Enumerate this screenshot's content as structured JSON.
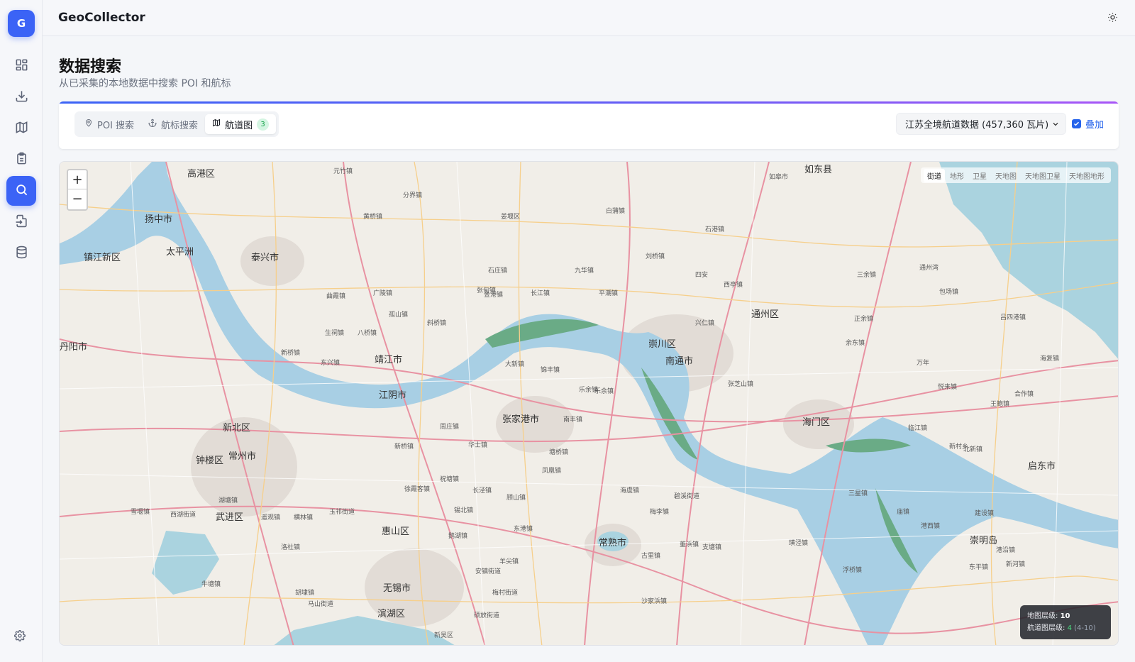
{
  "app": {
    "logo_letter": "G",
    "title": "GeoCollector"
  },
  "sidebar": {
    "items": [
      {
        "icon": "dashboard-icon"
      },
      {
        "icon": "download-icon"
      },
      {
        "icon": "map-icon"
      },
      {
        "icon": "clipboard-icon"
      },
      {
        "icon": "search-icon",
        "active": true
      },
      {
        "icon": "file-import-icon"
      },
      {
        "icon": "database-icon"
      }
    ],
    "settings_icon": "gear-icon"
  },
  "page": {
    "title": "数据搜索",
    "subtitle": "从已采集的本地数据中搜索 POI 和航标"
  },
  "tabs": [
    {
      "label": "POI 搜索",
      "icon": "pin-icon"
    },
    {
      "label": "航标搜索",
      "icon": "anchor-icon"
    },
    {
      "label": "航道图",
      "icon": "map-icon",
      "badge": "3",
      "active": true
    }
  ],
  "dataset": {
    "selected": "江苏全境航道数据 (457,360 瓦片)"
  },
  "overlay": {
    "label": "叠加",
    "checked": true
  },
  "map": {
    "zoom_in": "+",
    "zoom_out": "−",
    "layers": [
      "街道",
      "地形",
      "卫星",
      "天地图",
      "天地图卫星",
      "天地图地形"
    ],
    "active_layer": "街道",
    "info": {
      "map_zoom_label": "地图层级:",
      "map_zoom_value": "10",
      "chart_zoom_label": "航道图层级:",
      "chart_zoom_value": "4",
      "chart_zoom_range": "(4-10)"
    },
    "city_labels": [
      "高港区",
      "扬中市",
      "镇江新区",
      "泰兴市",
      "靖江市",
      "江阴市",
      "张家港市",
      "南通市",
      "崇川区",
      "通州区",
      "海门区",
      "启东市",
      "崇明岛",
      "常熟市",
      "无锡市",
      "常州市",
      "新北区",
      "钟楼区",
      "武进区",
      "惠山区",
      "滨湖区",
      "如东县",
      "太平洲",
      "丹阳市"
    ],
    "town_labels": [
      "如皋市",
      "白蒲镇",
      "石港镇",
      "九华镇",
      "平潮镇",
      "刘桥镇",
      "四安",
      "西亭镇",
      "兴仁镇",
      "张芝山镇",
      "三余镇",
      "通州湾",
      "包场镇",
      "吕四港镇",
      "海复镇",
      "正余镇",
      "余东镇",
      "万年",
      "悦来镇",
      "合作镇",
      "王鲍镇",
      "北新镇",
      "临江镇",
      "新村乡",
      "三星镇",
      "庙镇",
      "港西镇",
      "建设镇",
      "东平镇",
      "新河镇",
      "港沿镇",
      "支塘镇",
      "梅李镇",
      "碧溪街道",
      "海虞镇",
      "董浜镇",
      "古里镇",
      "沙家浜镇",
      "浮桥镇",
      "璜泾镇",
      "乐余镇",
      "锦丰镇",
      "大新镇",
      "金港镇",
      "长江镇",
      "孤山镇",
      "斜桥镇",
      "东兴镇",
      "新桥镇",
      "生祠镇",
      "八桥镇",
      "广陵镇",
      "曲霞镇",
      "黄桥镇",
      "分界镇",
      "元竹镇",
      "石庄镇",
      "张甸镇",
      "姜堰区",
      "周庄镇",
      "华士镇",
      "新桥镇",
      "长泾镇",
      "祝塘镇",
      "徐霞客镇",
      "顾山镇",
      "凤凰镇",
      "塘桥镇",
      "南丰镇",
      "乐余镇",
      "东港镇",
      "安镇街道",
      "鹅湖镇",
      "羊尖镇",
      "锡北镇",
      "洛社镇",
      "玉祁街道",
      "横林镇",
      "遥观镇",
      "湖塘镇",
      "西湖街道",
      "牛塘镇",
      "雪堰镇",
      "马山街道",
      "胡埭镇",
      "梅村街道",
      "硕放街道",
      "新吴区"
    ]
  }
}
